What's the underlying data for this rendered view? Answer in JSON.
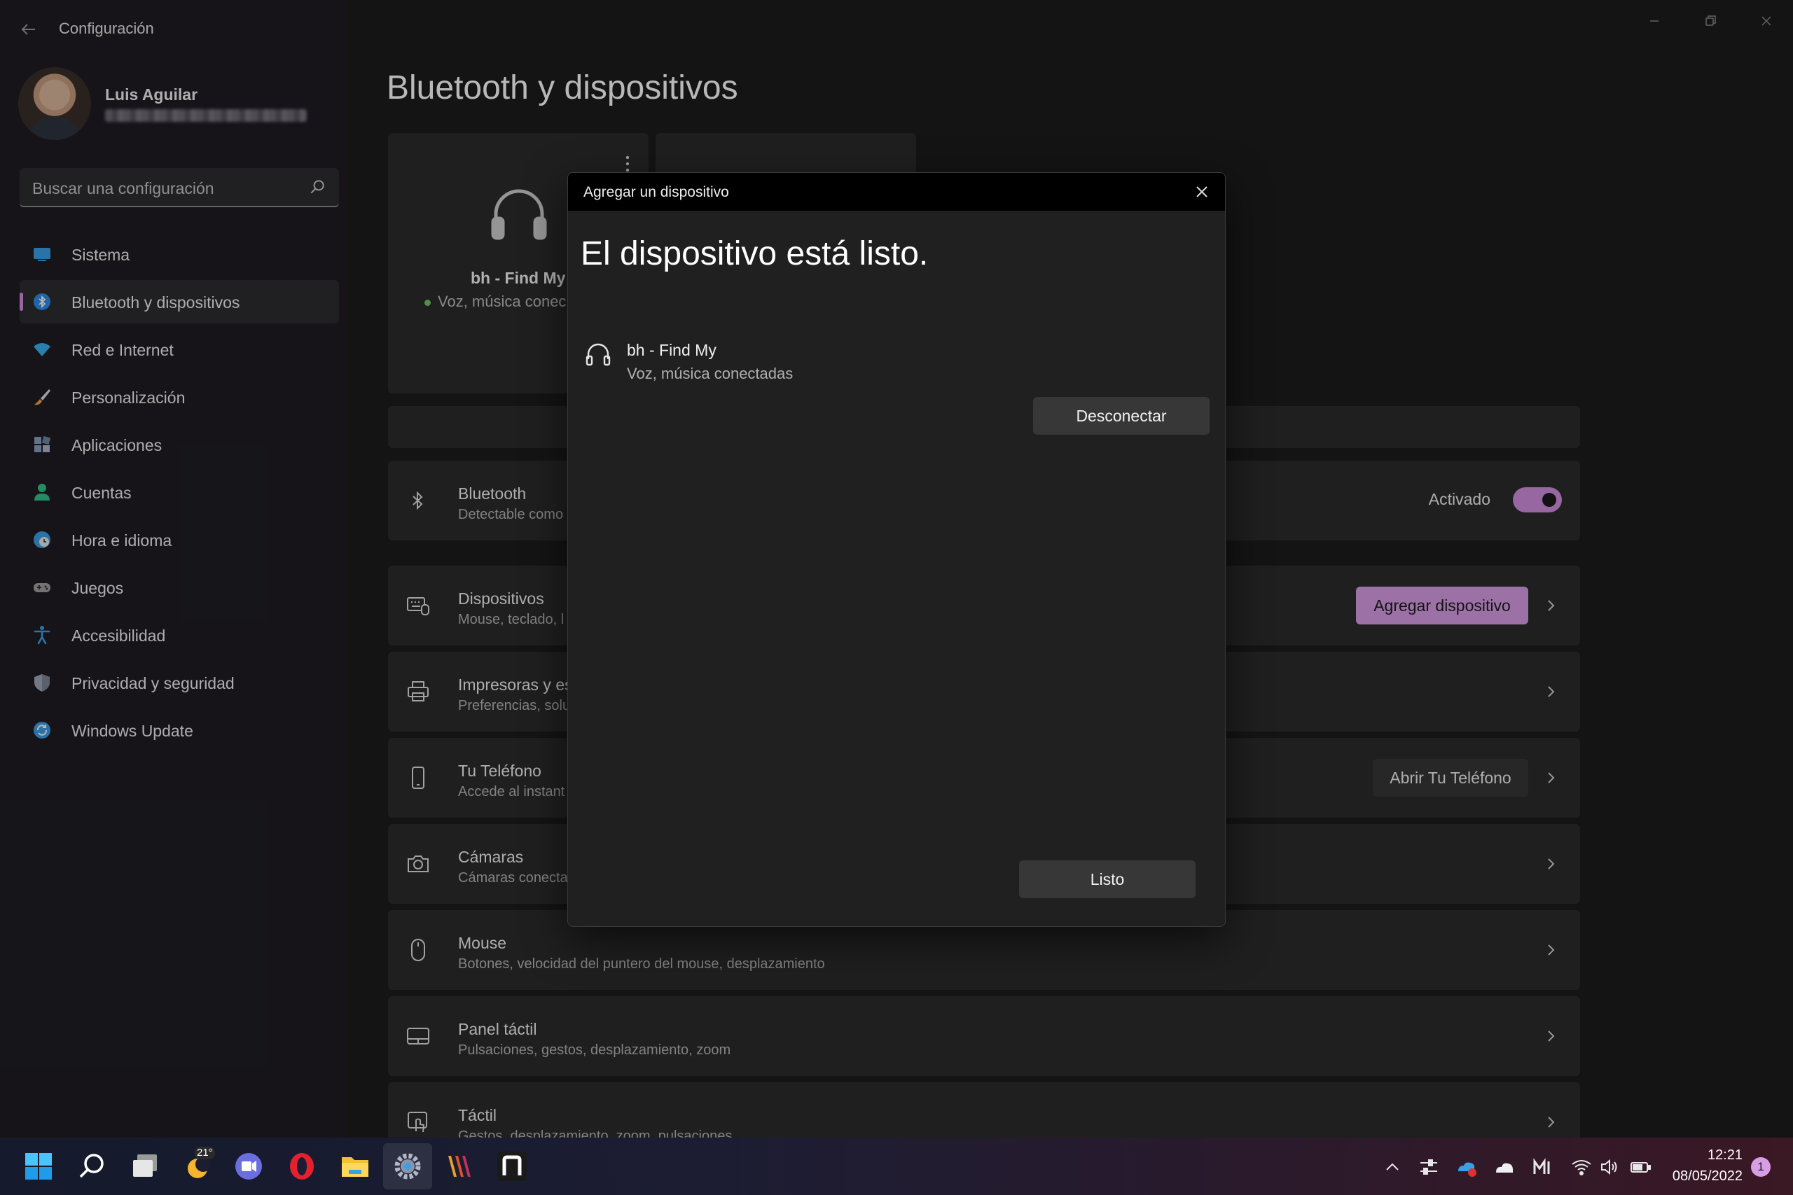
{
  "window": {
    "app_title": "Configuración"
  },
  "profile": {
    "name": "Luis Aguilar"
  },
  "search": {
    "placeholder": "Buscar una configuración"
  },
  "sidebar": {
    "items": [
      {
        "label": "Sistema",
        "icon": "system-icon",
        "color": "#3aa0e6"
      },
      {
        "label": "Bluetooth y dispositivos",
        "icon": "bluetooth-icon",
        "color": "#2f8ce8",
        "active": true
      },
      {
        "label": "Red e Internet",
        "icon": "wifi-icon",
        "color": "#3ab0f0"
      },
      {
        "label": "Personalización",
        "icon": "brush-icon",
        "color": "#f0a040"
      },
      {
        "label": "Aplicaciones",
        "icon": "apps-icon",
        "color": "#8aa0c0"
      },
      {
        "label": "Cuentas",
        "icon": "person-icon",
        "color": "#35c08a"
      },
      {
        "label": "Hora e idioma",
        "icon": "globe-clock-icon",
        "color": "#3aa0e6"
      },
      {
        "label": "Juegos",
        "icon": "gamepad-icon",
        "color": "#a0a0a0"
      },
      {
        "label": "Accesibilidad",
        "icon": "accessibility-icon",
        "color": "#3aa0f0"
      },
      {
        "label": "Privacidad y seguridad",
        "icon": "shield-icon",
        "color": "#a0a8b8"
      },
      {
        "label": "Windows Update",
        "icon": "update-icon",
        "color": "#3aa0e6"
      }
    ]
  },
  "main": {
    "page_title": "Bluetooth y dispositivos",
    "device_card": {
      "name": "bh - Find My",
      "status": "Voz, música conec"
    },
    "rows": {
      "bluetooth": {
        "title": "Bluetooth",
        "subtitle": "Detectable como",
        "toggle_label": "Activado",
        "toggle_on": true
      },
      "devices": {
        "title": "Dispositivos",
        "subtitle": "Mouse, teclado, l",
        "button": "Agregar dispositivo"
      },
      "printers": {
        "title": "Impresoras y es",
        "subtitle": "Preferencias, solu"
      },
      "phone": {
        "title": "Tu Teléfono",
        "subtitle": "Accede al instant",
        "button": "Abrir Tu Teléfono"
      },
      "cameras": {
        "title": "Cámaras",
        "subtitle": "Cámaras conecta"
      },
      "mouse": {
        "title": "Mouse",
        "subtitle": "Botones, velocidad del puntero del mouse, desplazamiento"
      },
      "touchpad": {
        "title": "Panel táctil",
        "subtitle": "Pulsaciones, gestos, desplazamiento, zoom"
      },
      "touch": {
        "title": "Táctil",
        "subtitle": "Gestos, desplazamiento, zoom, pulsaciones"
      }
    }
  },
  "dialog": {
    "title": "Agregar un dispositivo",
    "heading": "El dispositivo está listo.",
    "device_name": "bh - Find My",
    "device_status": "Voz, música conectadas",
    "disconnect_label": "Desconectar",
    "done_label": "Listo"
  },
  "taskbar": {
    "weather_temp": "21°",
    "time": "12:21",
    "date": "08/05/2022",
    "notifications": "1"
  },
  "colors": {
    "accent": "#d79de6",
    "background": "#1c1c1c",
    "card": "#2b2b2b"
  }
}
